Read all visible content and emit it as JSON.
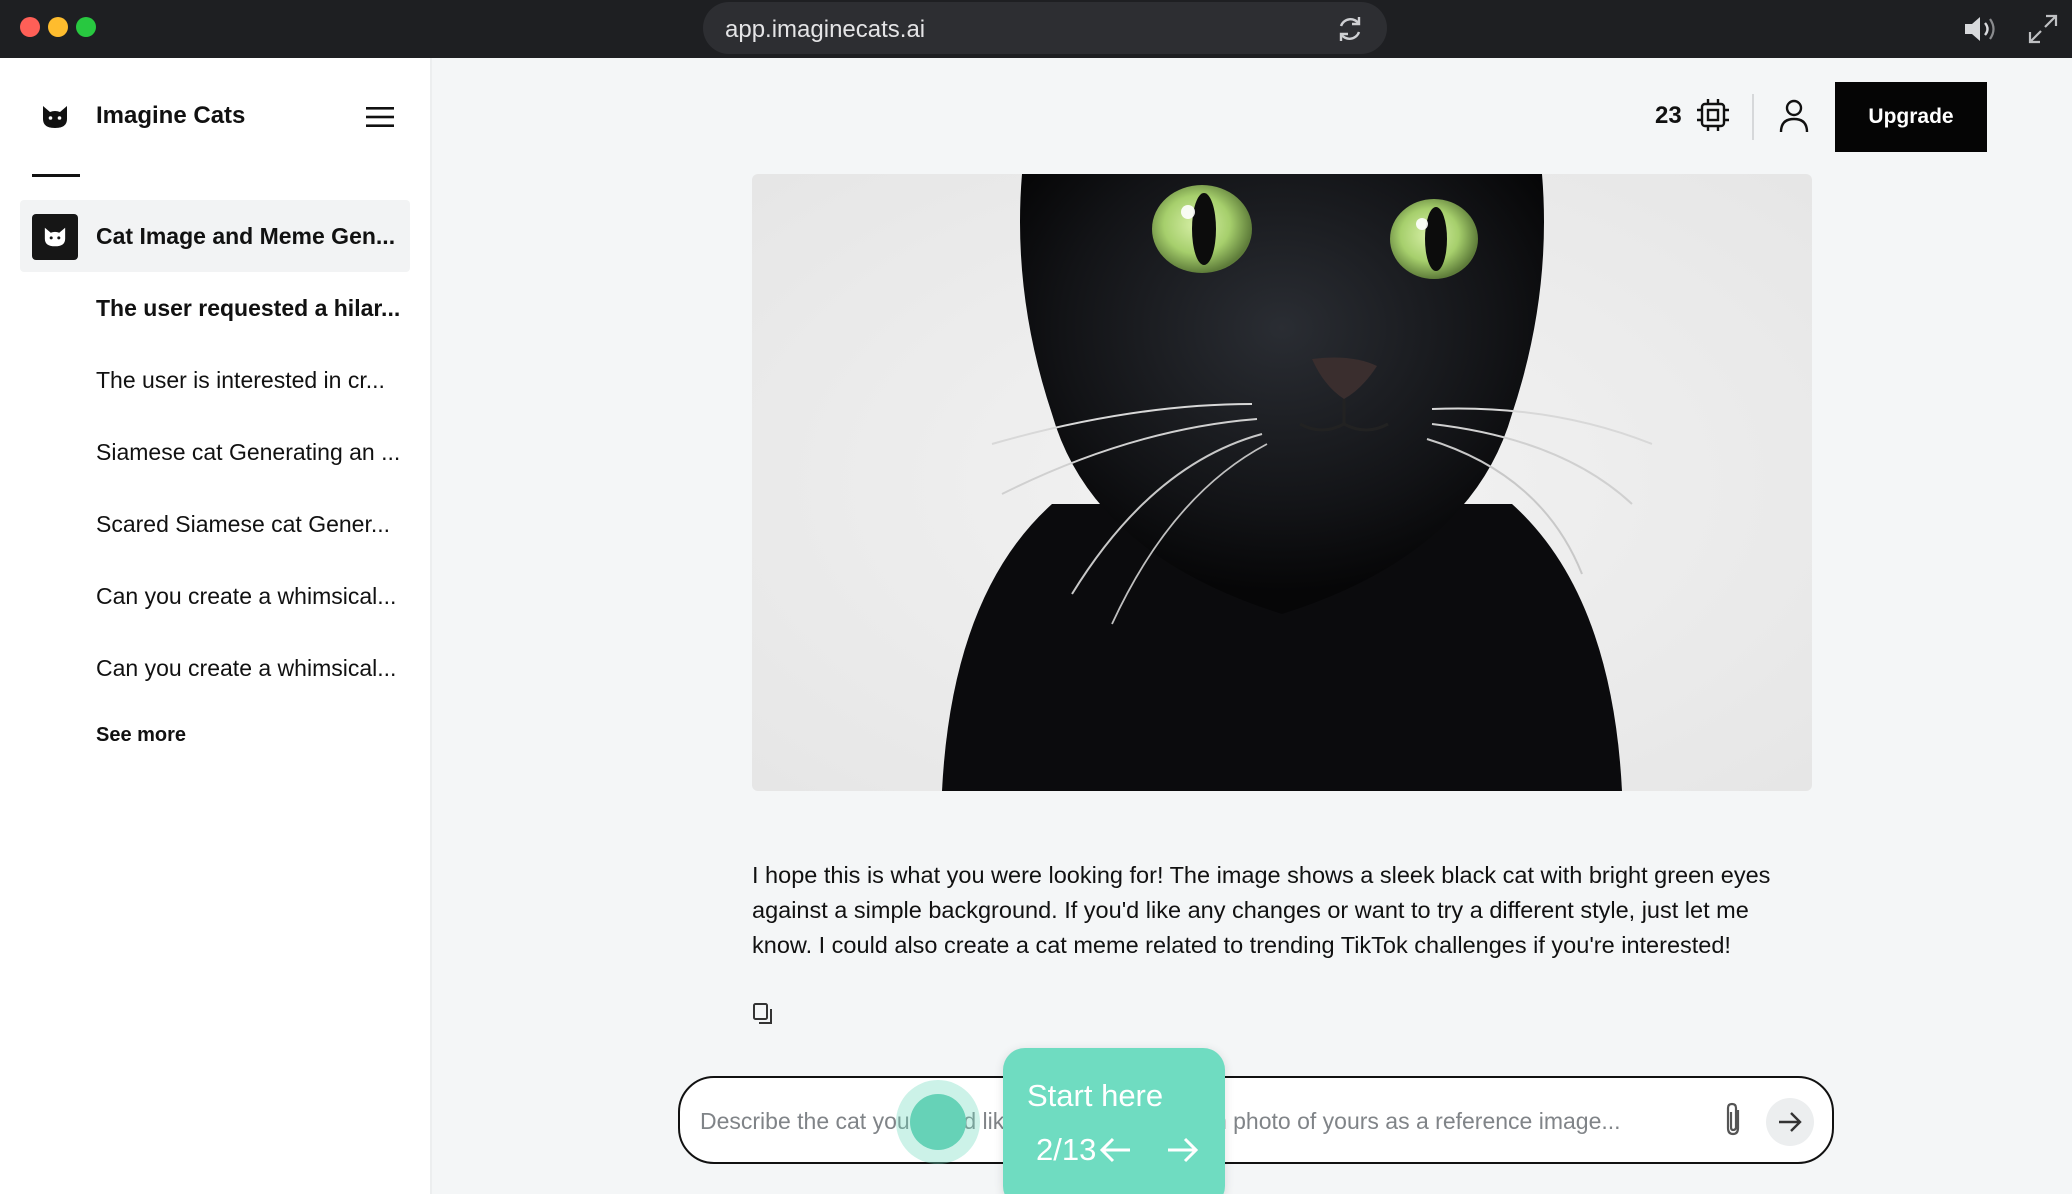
{
  "browser": {
    "url": "app.imaginecats.ai"
  },
  "sidebar": {
    "brand_name": "Imagine Cats",
    "items": [
      {
        "label": "Cat Image and Meme Gen..."
      },
      {
        "label": "The user requested a hilar..."
      },
      {
        "label": "The user is interested in cr..."
      },
      {
        "label": "Siamese cat Generating an ..."
      },
      {
        "label": "Scared Siamese cat Gener..."
      },
      {
        "label": "Can you create a whimsical..."
      },
      {
        "label": "Can you create a whimsical..."
      }
    ],
    "see_more": "See more"
  },
  "header": {
    "credits": "23",
    "upgrade_label": "Upgrade"
  },
  "message": {
    "text": "I hope this is what you were looking for! The image shows a sleek black cat with bright green eyes against a simple background. If you'd like any changes or want to try a different style, just let me know. I could also create a cat meme related to trending TikTok challenges if you're interested!"
  },
  "composer": {
    "placeholder": "Describe the cat you would like to see, or upload an photo of yours as a reference image..."
  },
  "tour": {
    "title": "Start here",
    "progress": "2/13",
    "color": "#6fdcc1"
  },
  "icons": {
    "reload": "reload-icon",
    "speaker": "speaker-icon",
    "expand": "expand-icon",
    "menu": "menu-icon",
    "chip": "chip-icon",
    "user": "user-icon",
    "copy": "copy-icon",
    "attach": "paperclip-icon",
    "send": "arrow-right-icon"
  }
}
